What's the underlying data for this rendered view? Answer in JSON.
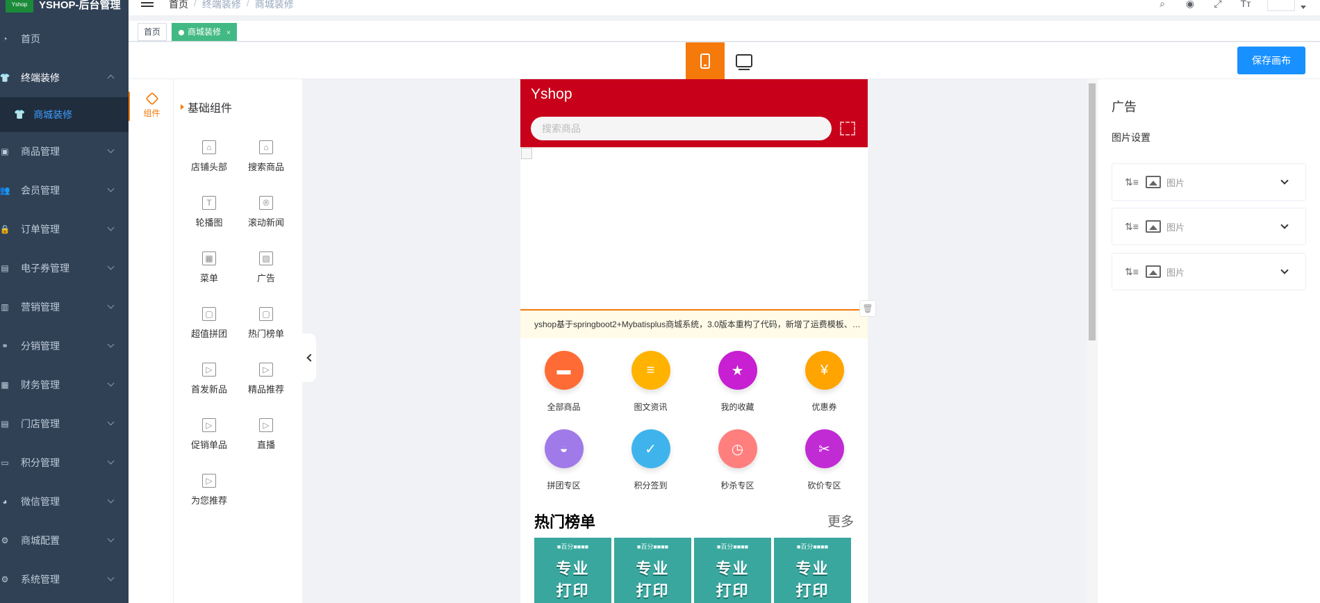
{
  "app": {
    "logo_text": "YSHOP-后台管理",
    "logo_badge": "Yshop"
  },
  "sidebar": {
    "items": [
      {
        "label": "首页",
        "icon": "dashboard-icon",
        "arrow": false
      },
      {
        "label": "终端装修",
        "icon": "shirt-icon",
        "arrow": "up",
        "open": true
      },
      {
        "label": "商城装修",
        "icon": "shirt-icon",
        "sub": true
      },
      {
        "label": "商品管理",
        "icon": "goods-icon",
        "arrow": "down"
      },
      {
        "label": "会员管理",
        "icon": "users-icon",
        "arrow": "down"
      },
      {
        "label": "订单管理",
        "icon": "lock-icon",
        "arrow": "down"
      },
      {
        "label": "电子券管理",
        "icon": "coupon-icon",
        "arrow": "down"
      },
      {
        "label": "营销管理",
        "icon": "chart-icon",
        "arrow": "down"
      },
      {
        "label": "分销管理",
        "icon": "share-icon",
        "arrow": "down"
      },
      {
        "label": "财务管理",
        "icon": "money-icon",
        "arrow": "down"
      },
      {
        "label": "门店管理",
        "icon": "store-icon",
        "arrow": "down"
      },
      {
        "label": "积分管理",
        "icon": "calendar-icon",
        "arrow": "down"
      },
      {
        "label": "微信管理",
        "icon": "wechat-icon",
        "arrow": "down"
      },
      {
        "label": "商城配置",
        "icon": "gear-icon",
        "arrow": "down"
      },
      {
        "label": "系统管理",
        "icon": "system-gear-icon",
        "arrow": "down"
      }
    ]
  },
  "navbar": {
    "breadcrumb": [
      "首页",
      "终端装修",
      "商城装修"
    ]
  },
  "tags": {
    "home": "首页",
    "active": "商城装修",
    "close": "×"
  },
  "toolbar": {
    "save_label": "保存画布"
  },
  "components": {
    "tab_label": "组件",
    "group_title": "基础组件",
    "items": [
      {
        "label": "店铺头部",
        "glyph": "⌂"
      },
      {
        "label": "搜索商品",
        "glyph": "⌂"
      },
      {
        "label": "轮播图",
        "glyph": "T"
      },
      {
        "label": "滚动新闻",
        "glyph": "®"
      },
      {
        "label": "菜单",
        "glyph": "▦"
      },
      {
        "label": "广告",
        "glyph": "▧"
      },
      {
        "label": "超值拼团",
        "glyph": "▢"
      },
      {
        "label": "热门榜单",
        "glyph": "▢"
      },
      {
        "label": "首发新品",
        "glyph": "▷"
      },
      {
        "label": "精品推荐",
        "glyph": "▷"
      },
      {
        "label": "促销单品",
        "glyph": "▷"
      },
      {
        "label": "直播",
        "glyph": "▷"
      },
      {
        "label": "为您推荐",
        "glyph": "▷"
      }
    ]
  },
  "preview": {
    "shop_name": "Yshop",
    "search_placeholder": "搜索商品",
    "news_text": "yshop基于springboot2+Mybatisplus商城系统，3.0版本重构了代码，新增了运费模板、…",
    "menu": [
      {
        "label": "全部商品",
        "color": "#ff6b35",
        "glyph": "▬"
      },
      {
        "label": "图文资讯",
        "color": "#ffb300",
        "glyph": "≡"
      },
      {
        "label": "我的收藏",
        "color": "#c71fd1",
        "glyph": "★"
      },
      {
        "label": "优惠券",
        "color": "#ffa400",
        "glyph": "¥"
      },
      {
        "label": "拼团专区",
        "color": "#a07ae8",
        "glyph": "◒"
      },
      {
        "label": "积分签到",
        "color": "#3fb4ec",
        "glyph": "✓"
      },
      {
        "label": "秒杀专区",
        "color": "#ff7f7f",
        "glyph": "◷"
      },
      {
        "label": "砍价专区",
        "color": "#c02bd4",
        "glyph": "✂"
      }
    ],
    "hot_title": "热门榜单",
    "hot_more": "更多",
    "hot_cards": [
      {
        "top": "■百分■■■■",
        "line1": "专业",
        "line2": "打印"
      },
      {
        "top": "■百分■■■■",
        "line1": "专业",
        "line2": "打印"
      },
      {
        "top": "■百分■■■■",
        "line1": "专业",
        "line2": "打印"
      },
      {
        "top": "■百分■■■■",
        "line1": "专业",
        "line2": "打印"
      }
    ]
  },
  "properties": {
    "title": "广告",
    "subtitle": "图片设置",
    "rows": [
      {
        "label": "图片"
      },
      {
        "label": "图片"
      },
      {
        "label": "图片"
      }
    ]
  },
  "colors": {
    "sidebar_bg": "#304156",
    "accent_orange": "#f5790b",
    "primary_blue": "#1890ff",
    "shop_red": "#c8001a",
    "tag_green": "#42b983"
  }
}
